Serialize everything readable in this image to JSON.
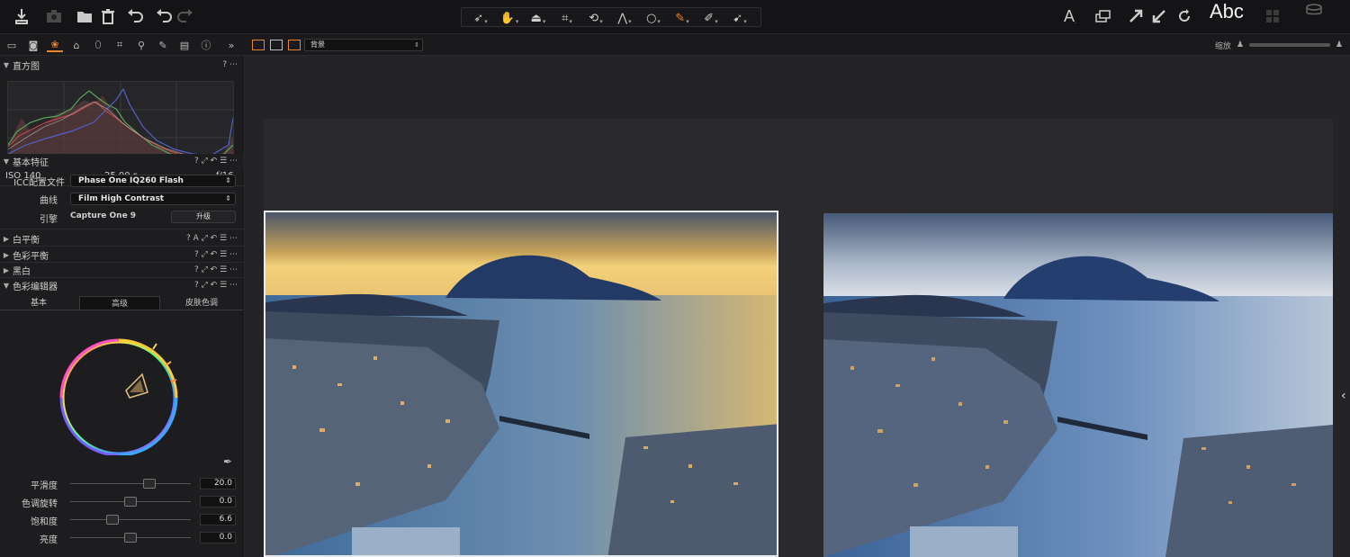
{
  "toolbar": {
    "left_icons": [
      "import-icon",
      "camera-icon",
      "folder-icon",
      "trash-icon",
      "undo-icon",
      "undo-alt-icon",
      "redo-icon"
    ],
    "tools": [
      {
        "name": "select-icon",
        "glyph": "➶"
      },
      {
        "name": "pan-icon",
        "glyph": "✋"
      },
      {
        "name": "mask-icon",
        "glyph": "⏏"
      },
      {
        "name": "crop-icon",
        "glyph": "⌗"
      },
      {
        "name": "rotate-icon",
        "glyph": "⟲"
      },
      {
        "name": "keystone-icon",
        "glyph": "⋀"
      },
      {
        "name": "spot-icon",
        "glyph": "○"
      },
      {
        "name": "brush-icon",
        "glyph": "✎"
      },
      {
        "name": "picker-icon",
        "glyph": "✐"
      },
      {
        "name": "annotation-icon",
        "glyph": "➹"
      }
    ],
    "right_label": "Abc"
  },
  "left_panel": {
    "histogram": {
      "title": "直方图",
      "iso": "ISO 140",
      "shutter": "25.00 s",
      "aperture": "f/16"
    },
    "base": {
      "title": "基本特征",
      "icc_label": "ICC配置文件",
      "icc_value": "Phase One IQ260 Flash",
      "curve_label": "曲线",
      "curve_value": "Film High Contrast",
      "engine_label": "引擎",
      "engine_value": "Capture One 9",
      "update_btn": "升级"
    },
    "sections": [
      {
        "title": "白平衡"
      },
      {
        "title": "色彩平衡"
      },
      {
        "title": "黑白"
      },
      {
        "title": "色彩编辑器"
      }
    ],
    "editor_tabs": [
      "基本",
      "高级",
      "皮肤色调"
    ],
    "sliders": [
      {
        "label": "平滑度",
        "value": "20.0",
        "pos": 0.66
      },
      {
        "label": "色调旋转",
        "value": "0.0",
        "pos": 0.5
      },
      {
        "label": "饱和度",
        "value": "6.6",
        "pos": 0.35
      },
      {
        "label": "亮度",
        "value": "0.0",
        "pos": 0.5
      }
    ]
  },
  "viewer": {
    "select_value": "背景",
    "right_text": "缩放"
  },
  "colors": {
    "accent": "#e8872a",
    "panel": "#1d1d1f",
    "viewer": "#242427"
  }
}
